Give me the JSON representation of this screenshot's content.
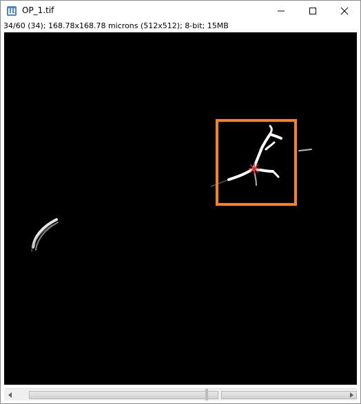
{
  "window": {
    "title": "OP_1.tif",
    "icon": "imagej-icon",
    "controls": [
      "minimize-icon",
      "maximize-icon",
      "close-icon"
    ]
  },
  "info": {
    "text": "34/60 (34); 168.78x168.78 microns (512x512); 8-bit; 15MB"
  },
  "image": {
    "background": "#000000",
    "roi_color": "#f58220",
    "marker_color": "#d4282c"
  },
  "scrollbar": {
    "icons": [
      "arrow-left-icon",
      "arrow-right-icon"
    ],
    "position_fraction": 0.57
  }
}
